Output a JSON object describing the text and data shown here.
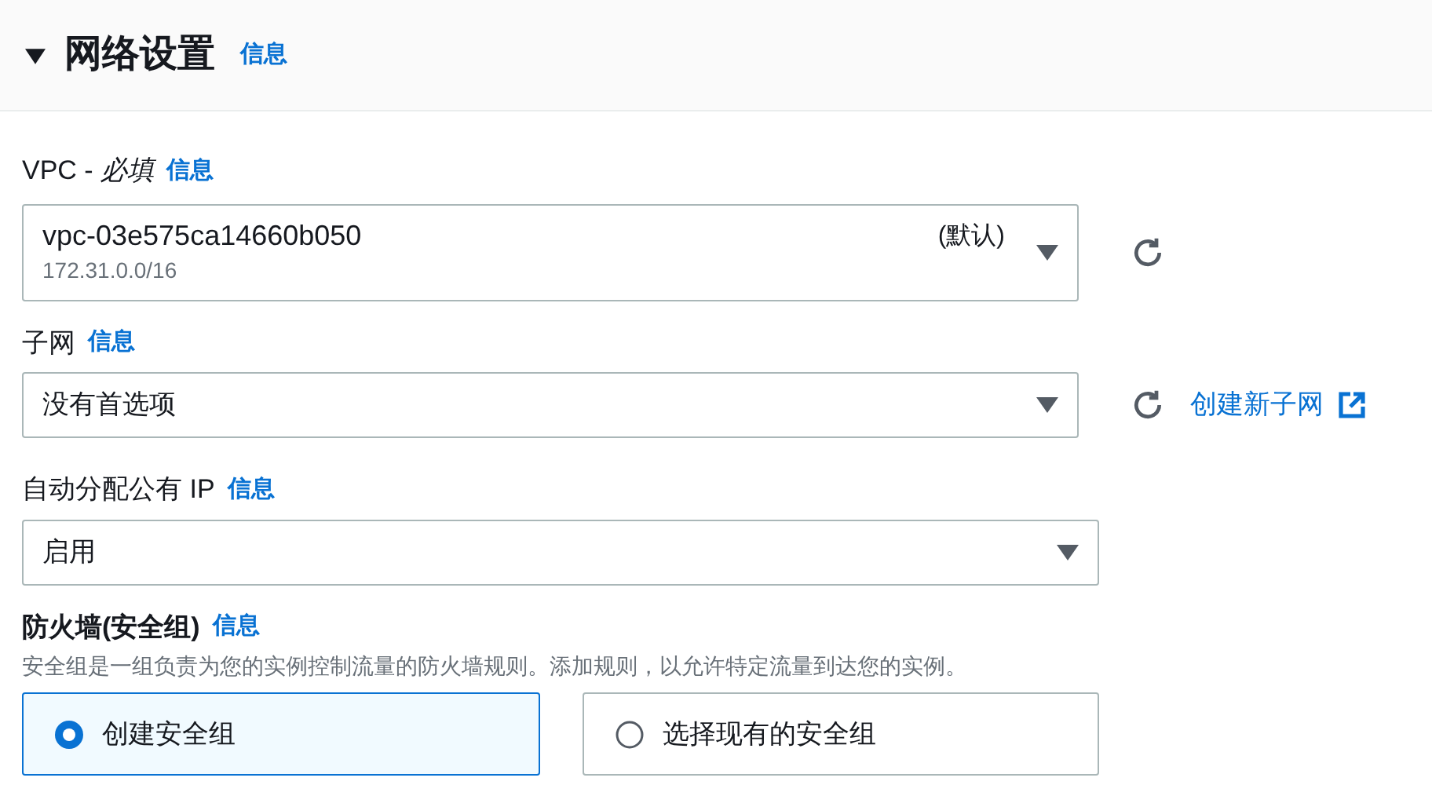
{
  "section": {
    "title": "网络设置",
    "info": "信息",
    "expanded": true
  },
  "vpc": {
    "label": "VPC - ",
    "required": "必填",
    "info": "信息",
    "value": "vpc-03e575ca14660b050",
    "detail": "172.31.0.0/16",
    "tag": "(默认)"
  },
  "subnet": {
    "label": "子网",
    "info": "信息",
    "value": "没有首选项",
    "link": "创建新子网"
  },
  "auto_ip": {
    "label": "自动分配公有 IP",
    "info": "信息",
    "value": "启用"
  },
  "firewall": {
    "label": "防火墙(安全组)",
    "info": "信息",
    "description": "安全组是一组负责为您的实例控制流量的防火墙规则。添加规则，以允许特定流量到达您的实例。",
    "options": [
      {
        "label": "创建安全组",
        "selected": true
      },
      {
        "label": "选择现有的安全组",
        "selected": false
      }
    ]
  }
}
